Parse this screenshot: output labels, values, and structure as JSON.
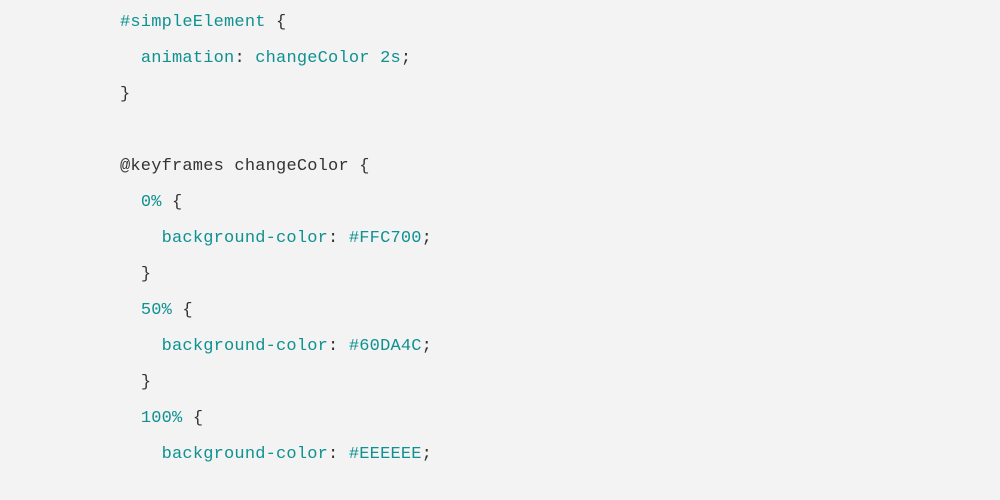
{
  "code": {
    "l1_sel": "#simpleElement",
    "l1_brace": " {",
    "l2_indent": "  ",
    "l2_prop": "animation",
    "l2_colon": ": ",
    "l2_val": "changeColor 2s",
    "l2_semi": ";",
    "l3_brace": "}",
    "l5_at": "@keyframes",
    "l5_name": " changeColor ",
    "l5_brace": "{",
    "l6_indent": "  ",
    "l6_pct": "0%",
    "l6_brace": " {",
    "l7_indent": "    ",
    "l7_prop": "background-color",
    "l7_colon": ": ",
    "l7_val": "#FFC700",
    "l7_semi": ";",
    "l8_indent": "  ",
    "l8_brace": "}",
    "l9_indent": "  ",
    "l9_pct": "50%",
    "l9_brace": " {",
    "l10_indent": "    ",
    "l10_prop": "background-color",
    "l10_colon": ": ",
    "l10_val": "#60DA4C",
    "l10_semi": ";",
    "l11_indent": "  ",
    "l11_brace": "}",
    "l12_indent": "  ",
    "l12_pct": "100%",
    "l12_brace": " {",
    "l13_indent": "    ",
    "l13_prop": "background-color",
    "l13_colon": ": ",
    "l13_val": "#EEEEEE",
    "l13_semi": ";"
  }
}
